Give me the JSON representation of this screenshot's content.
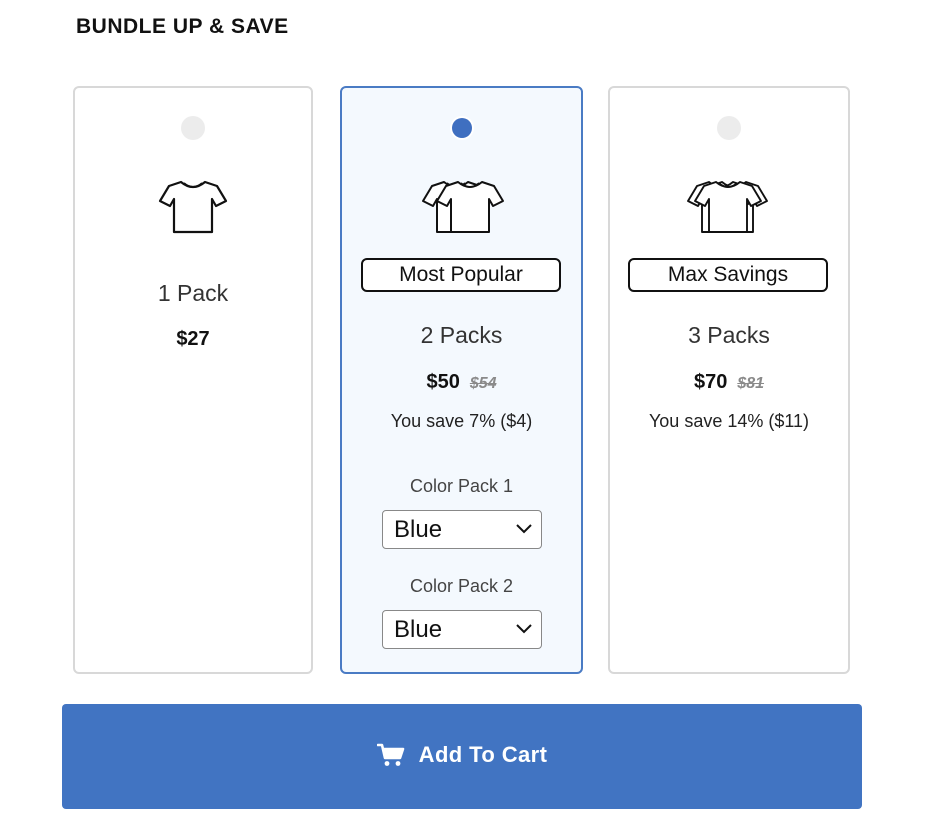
{
  "header": {
    "title": "BUNDLE UP & SAVE"
  },
  "bundles": [
    {
      "name": "1 Pack",
      "price": "$27",
      "selected": false,
      "icon": "tshirt-icon"
    },
    {
      "name": "2 Packs",
      "badge": "Most Popular",
      "price": "$50",
      "old_price": "$54",
      "savings": "You save 7% ($4)",
      "selected": true,
      "icon": "two-tshirts-icon",
      "color_selectors": [
        {
          "label": "Color Pack 1",
          "value": "Blue"
        },
        {
          "label": "Color Pack 2",
          "value": "Blue"
        }
      ]
    },
    {
      "name": "3 Packs",
      "badge": "Max Savings",
      "price": "$70",
      "old_price": "$81",
      "savings": "You save 14% ($11)",
      "selected": false,
      "icon": "three-tshirts-icon"
    }
  ],
  "cart": {
    "label": "Add To Cart",
    "icon": "shopping-cart-icon"
  },
  "colors": {
    "accent": "#4174c2",
    "selected_border": "#4a7bc4",
    "selected_bg": "#f4f9fe",
    "card_border": "#d8d8d8"
  }
}
